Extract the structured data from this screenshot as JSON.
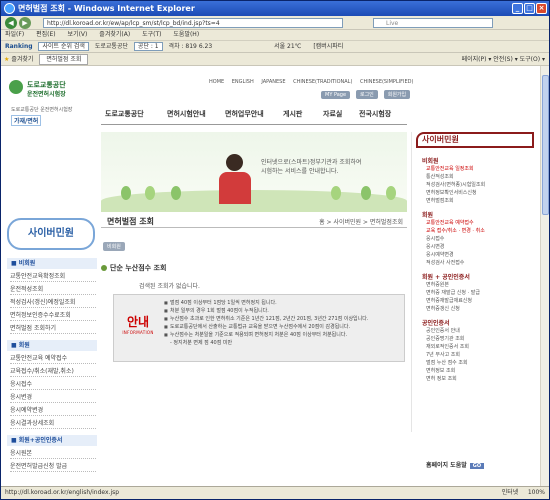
{
  "window": {
    "title": "면허벌점 조회 - Windows Internet Explorer"
  },
  "addressbar": {
    "url": "http://dl.koroad.or.kr/ew/ap/lcp_sm/st/lcp_bd/ind.jsp?ts=4",
    "search_placeholder": "Live"
  },
  "menubar": {
    "items": [
      "파일(F)",
      "편집(E)",
      "보기(V)",
      "즐겨찾기(A)",
      "도구(T)",
      "도움말(H)"
    ]
  },
  "toolbar": {
    "brand": "Ranking",
    "search_value": "사이트 순위 검색",
    "site": "도로교통공단",
    "item1": "공단 : 1",
    "item2": "격차 : 819",
    "item3": "6.23",
    "weather": "서울 21℃",
    "right": "[캠버시파티"
  },
  "favbar": {
    "fav_label": "즐겨찾기",
    "tab_label": "면허벌점 조회",
    "tools": "페이지(P) ▾   안전(S) ▾   도구(O) ▾"
  },
  "site": {
    "logo_line1": "도로교통공단",
    "logo_line2": "운전면허시험장",
    "logo_sub": "도로교통공단 운전면허시험장",
    "logo_tag": "가재/면허",
    "toplinks": [
      "HOME",
      "ENGLISH",
      "JAPANESE",
      "CHINESE(TRADITIONAL)",
      "CHINESE(SIMPLIFIED)"
    ],
    "minibtns": [
      "MY Page",
      "로그인",
      "회원가입"
    ],
    "gnb": [
      "도로교통공단",
      "면허시험안내",
      "면허업무안내",
      "게시판",
      "자료실",
      "전국시험장"
    ],
    "banner_text": [
      "인터넷으로(스마트)정부기관과 조회하여",
      "시험하는 서비스를 안내합니다."
    ]
  },
  "left": {
    "title": "사이버민원",
    "cat1": "■ 비회원",
    "cat1_items": [
      "교통안전교육확정조회",
      "운전적성조회",
      "적성검사(갱신)예정일조회",
      "면허정보인증수수료조회",
      "면허벌점 조회하기"
    ],
    "cat2": "■ 회원",
    "cat2_items": [
      "교통안전교육 예약접수",
      "교육접수/취소(재발,취소)",
      "응시접수",
      "응시변경",
      "응시예약변경",
      "응시결과상세조회"
    ],
    "cat3": "■ 회원+공인인증서",
    "cat3_items": [
      "응시원본",
      "운전면허발급신청 발급"
    ]
  },
  "page": {
    "title": "면허벌점 조회",
    "breadcrumb": "홈 > 사이버민원 > 면허벌점조회",
    "tag": "비회원",
    "subtitle": "단순 누산점수 조회",
    "noresult": "검색된 조회가 없습니다.",
    "badge_label": "INFORMATION",
    "badge_icon": "안내",
    "info_lines": [
      "벌점 40점 이상부터 1점당 1일씩 면허정지 됩니다.",
      "처분 일부의 경우 1회 벌점 40점이 누적됩니다.",
      "누산점수 초과로 인한 면허취소 기준은 1년간 121점, 2년간 201점, 3년간 271점 이상입니다.",
      "도로교통공단에서 산출하는 교통법규 교육을 받으면 누산점수에서 20점이 감경됩니다.",
      "누산점수는 처분일을 기준으로 적용되며 면허정지 처분은 40점 이상부터 처분됩니다.",
      "- 정지처분 면제 점 40점 미만"
    ]
  },
  "right": {
    "title": "사이버민원",
    "sec1": "비회원",
    "sec1_items": [
      "교통안전교육 일정조회",
      "통산적성조회",
      "적성검사(면허종)시험일조회",
      "면허정보확인서비스신청",
      "면허벌점조회"
    ],
    "sec2": "회원",
    "sec2_items": [
      "교통안전교육 예약접수",
      "교육 접수/취소 · 변경 · 취소",
      "응시접수",
      "응시변경",
      "응시예약변경",
      "적성검사 사전접수"
    ],
    "sec3": "회원 + 공인인증서",
    "sec3_items": [
      "면허증원본",
      "면허증 재발급 신청 · 발급",
      "면허증재발급재료신청",
      "면허증갱신 신청"
    ],
    "sec4": "공인인증서",
    "sec4_items": [
      "공인인증서 안내",
      "공인증명기관 조회",
      "재외로적인증서 조회",
      "7년 무사고 조회",
      "벌점 누산 점수 조회",
      "면허정보 조회",
      "면허 정보 조회"
    ],
    "help": "홈페이지 도움말",
    "help_go": "GO"
  },
  "status": {
    "url": "http://dl.koroad.or.kr/english/index.jsp",
    "zone": "인터넷",
    "zoom": "100%"
  }
}
